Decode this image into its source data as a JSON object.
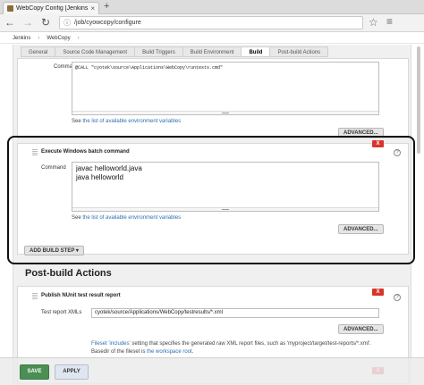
{
  "browser": {
    "tab_title": "WebCopy Config [Jenkins",
    "tab_close": "×",
    "new_tab": "+",
    "back_icon": "←",
    "forward_icon": "→",
    "reload_icon": "↻",
    "address": "/job/cyowcopy/configure",
    "star_icon": "☆",
    "menu_icon": "≡"
  },
  "breadcrumb": {
    "items": [
      "Jenkins",
      "WebCopy"
    ],
    "separator": "›"
  },
  "config_tabs": [
    "General",
    "Source Code Management",
    "Build Triggers",
    "Build Environment",
    "Build",
    "Post-build Actions"
  ],
  "build": {
    "first_step": {
      "command_label": "Command",
      "command_value": "@CALL \"cyotek\\source\\Applications\\WebCopy\\runtests.cmd\"",
      "env_prefix": "See ",
      "env_link": "the list of available environment variables",
      "advanced_label": "ADVANCED..."
    },
    "second_step": {
      "title": "Execute Windows batch command",
      "delete_label": "X",
      "help": "?",
      "command_label": "Command",
      "lines": [
        "javac helloworld.java",
        "java helloworld"
      ],
      "env_prefix": "See ",
      "env_link": "the list of available environment variables",
      "advanced_label": "ADVANCED..."
    },
    "add_step_label": "ADD BUILD STEP ▾"
  },
  "post_build": {
    "heading": "Post-build Actions",
    "nunit": {
      "title": "Publish NUnit test result report",
      "delete_label": "X",
      "help": "?",
      "field_label": "Test report XMLs",
      "field_value": "cyotek/source/Applications/WebCopy/testresults/*.xml",
      "advanced_label": "ADVANCED...",
      "fileset_link": "Fileset 'includes'",
      "fileset_text_1": " setting that specifies the generated raw XML report files, such as 'myproject/target/test-reports/*.xml'.",
      "fileset_text_2": "Basedir of the fileset is ",
      "fileset_link_2": "the workspace root",
      "fileset_end": "."
    },
    "second_delete_label": "X"
  },
  "actions": {
    "save_label": "SAVE",
    "apply_label": "APPLY"
  },
  "colors": {
    "save": "#4b8f54",
    "delete": "#d9342b",
    "link": "#2f6fb2"
  }
}
